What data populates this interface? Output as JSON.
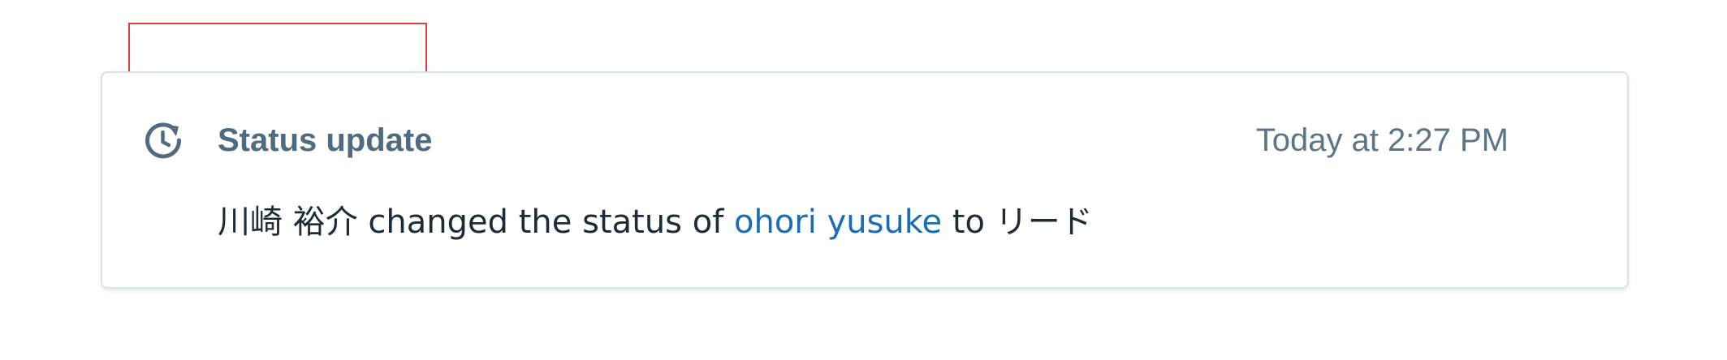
{
  "card": {
    "icon": "history-clock-icon",
    "title": "Status update",
    "timestamp": "Today at 2:27 PM",
    "message": {
      "actor": "川崎 裕介",
      "verb": " changed the status of ",
      "target": "ohori yusuke",
      "connector": " to ",
      "status": "リード"
    }
  },
  "colors": {
    "highlight_bracket": "#e0413f",
    "link": "#1a6db4",
    "title": "#4f6b80",
    "card_border": "#d6e2ec"
  }
}
